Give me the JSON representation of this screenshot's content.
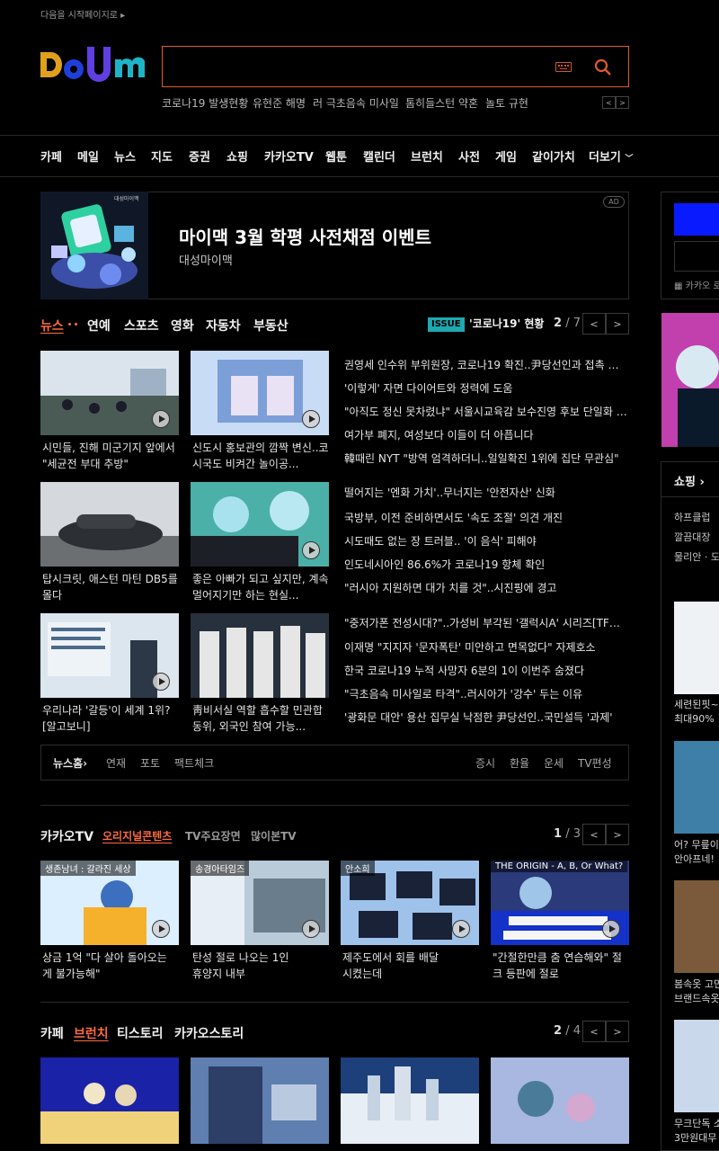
{
  "top": {
    "startpage_label": "다음을 시작페이지로"
  },
  "logo": {
    "letters": [
      "D",
      "a",
      "u",
      "m"
    ]
  },
  "trending": [
    "코로나19 발생현황",
    "유현준 해명",
    "러 극초음속 미사일",
    "톰히들스턴 약혼",
    "놀토 규현"
  ],
  "nav": [
    "카페",
    "메일",
    "뉴스",
    "지도",
    "증권",
    "쇼핑",
    "카카오TV",
    "웹툰",
    "캘린더",
    "브런치",
    "사전",
    "게임",
    "같이가치",
    "더보기"
  ],
  "ad": {
    "title": "마이맥 3월 학평 사전채점 이벤트",
    "sub": "대성마이맥",
    "badge": "AD",
    "logo_text": "대성마이맥"
  },
  "news": {
    "tabs": [
      "뉴스",
      "연예",
      "스포츠",
      "영화",
      "자동차",
      "부동산"
    ],
    "issue_badge": "ISSUE",
    "issue_text": "'코로나19' 현황",
    "page": "2",
    "total": "/ 7",
    "cards": [
      {
        "caption": "시민들, 진해 미군기지 앞에서 \"세균전 부대 추방\"",
        "video": true
      },
      {
        "caption": "신도시 홍보관의 깜짝 변신..코시국도 비켜간 놀이공...",
        "video": true
      },
      {
        "caption": "탑시크릿, 애스턴 마틴 DB5를 몰다",
        "video": false
      },
      {
        "caption": "좋은 아빠가 되고 싶지만, 계속 멀어지기만 하는 현실...",
        "video": true
      },
      {
        "caption": "우리나라 '갈등'이 세계 1위? [알고보니]",
        "video": true
      },
      {
        "caption": "靑비서실 역할 흡수할 민관합동위, 외국인 참여 가능...",
        "video": false
      }
    ],
    "headlines": [
      "권영세 인수위 부위원장, 코로나19 확진..尹당선인과 접촉 없었다",
      "'이렇게' 자면 다이어트와 정력에 도움",
      "\"아직도 정신 못차렸냐\" 서울시교육감 보수진영 후보 단일화 난항",
      "여가부 폐지, 여성보다 이들이 더 아픕니다",
      "韓때린 NYT \"방역 엄격하더니..일일확진 1위에 집단 무관심\"",
      "떨어지는 '엔화 가치'..무너지는 '안전자산' 신화",
      "국방부, 이전 준비하면서도 '속도 조절' 의견 개진",
      "시도때도 없는 장 트러블.. '이 음식' 피해야",
      "인도네시아인 86.6%가 코로나19 항체 확인",
      "\"러시아 지원하면 대가 치를 것\"..시진핑에 경고",
      "\"중저가폰 전성시대?\"..가성비 부각된 '갤럭시A' 시리즈[TF초점]",
      "이재명 \"지지자 '문자폭탄' 미안하고 면목없다\" 자제호소",
      "한국 코로나19 누적 사망자 6분의 1이 이번주 숨졌다",
      "\"극초음속 미사일로 타격\"..러시아가 '강수' 두는 이유",
      "'광화문 대안' 용산 집무실 낙점한 尹당선인..국민설득 '과제'"
    ],
    "footer": {
      "home": "뉴스홈",
      "links": [
        "연재",
        "포토",
        "팩트체크"
      ],
      "right": [
        "증시",
        "환율",
        "운세",
        "TV편성"
      ]
    }
  },
  "kakaotv": {
    "title": "카카오TV",
    "tabs": [
      "오리지널콘텐츠",
      "TV주요장면",
      "많이본TV"
    ],
    "page": "1",
    "total": "/ 3",
    "cards": [
      {
        "chip": "생존남녀 : 갈라진 세상",
        "caption": "상금 1억 \"다 살아 돌아오는 게 불가능해\""
      },
      {
        "chip": "송경아타임즈",
        "caption": "탄성 절로 나오는 1인 휴양지 내부"
      },
      {
        "chip": "안소희",
        "caption": "제주도에서 회를 배달시켰는데"
      },
      {
        "chip": "THE ORIGIN - A, B, Or What?",
        "caption": "\"간절한만큼 춤 연습해와\" 절크 등판에 절로"
      }
    ]
  },
  "cafe": {
    "tabs": [
      "카페",
      "브런치",
      "티스토리",
      "카카오스토리"
    ],
    "active": 1,
    "page": "2",
    "total": "/ 4"
  },
  "right_panel": {
    "kakao_label": "카카오 로",
    "shopping_title": "쇼핑",
    "shop_lines": [
      "하프클럽",
      "깔끔대장",
      "물리안 · 도"
    ],
    "products": [
      "세련된핏~",
      "최대90%",
      "어? 무릎이",
      "안아프네!",
      "봄속옷 고민",
      "브랜드속옷",
      "무크단독 소",
      "3만원대무"
    ]
  }
}
